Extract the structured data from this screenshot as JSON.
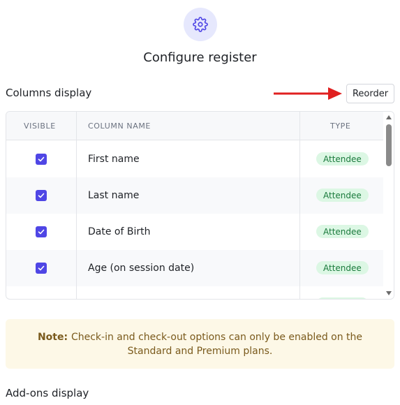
{
  "header": {
    "icon": "gear-icon",
    "title": "Configure register"
  },
  "columns_section": {
    "label": "Columns display",
    "reorder_label": "Reorder"
  },
  "table": {
    "headers": {
      "visible": "VISIBLE",
      "column_name": "COLUMN NAME",
      "type": "TYPE"
    },
    "rows": [
      {
        "visible": true,
        "name": "First name",
        "type": "Attendee"
      },
      {
        "visible": true,
        "name": "Last name",
        "type": "Attendee"
      },
      {
        "visible": true,
        "name": "Date of Birth",
        "type": "Attendee"
      },
      {
        "visible": true,
        "name": "Age (on session date)",
        "type": "Attendee"
      },
      {
        "visible": true,
        "name": "",
        "type": "Attendee"
      }
    ]
  },
  "note": {
    "label": "Note:",
    "text": "Check-in and check-out options can only be enabled on the Standard and Premium plans."
  },
  "addons_section": {
    "label": "Add-ons display"
  },
  "colors": {
    "accent": "#4f46e5",
    "badge_bg": "#dcf7e4",
    "badge_text": "#1a7a3c",
    "note_bg": "#fdf8e7",
    "arrow": "#e02020"
  }
}
